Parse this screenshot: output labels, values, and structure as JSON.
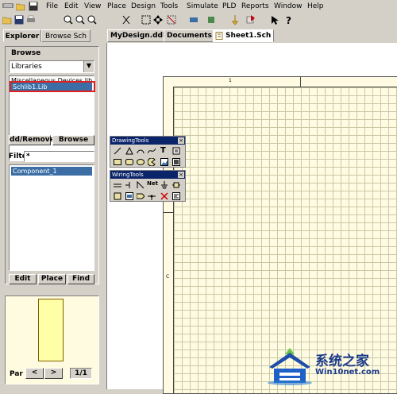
{
  "menu": {
    "items": [
      "File",
      "Edit",
      "View",
      "Place",
      "Design",
      "Tools",
      "Simulate",
      "PLD",
      "Reports",
      "Window",
      "Help"
    ]
  },
  "toolbar": {
    "icons": [
      "open-icon",
      "save-icon",
      "print-icon",
      "zoom-in-icon",
      "zoom-out-icon",
      "zoom-fit-icon",
      "cut-icon",
      "copy-icon",
      "paste-icon",
      "select-icon",
      "move-icon",
      "deselect-icon",
      "wire-icon",
      "component-icon",
      "help-icon"
    ]
  },
  "panel": {
    "tabs": {
      "explorer": "Explorer",
      "browse": "Browse Sch"
    },
    "browse_label": "Browse",
    "combo_value": "Libraries",
    "library_list": {
      "item_cut": "Miscellaneous Devices.lib",
      "selected": "Schlib1.Lib"
    },
    "buttons": {
      "add_remove": "dd/Remove",
      "browse": "Browse"
    },
    "filter_label": "Filte",
    "filter_value": "*",
    "components": [
      "Component_1"
    ],
    "comp_buttons": {
      "edit": "Edit",
      "place": "Place",
      "find": "Find"
    },
    "part_label": "Par",
    "nav_prev": "<",
    "nav_next": ">",
    "part_count": "1/1"
  },
  "doctabs": {
    "tab1": "MyDesign.ddb",
    "tab2": "Documents",
    "tab3": "Sheet1.Sch"
  },
  "sheet": {
    "top_marker": "1",
    "side_marker": "C"
  },
  "drawing_tools": {
    "title": "DrawingTools",
    "close": "×",
    "text_tool": "T"
  },
  "wiring_tools": {
    "title": "WiringTools",
    "close": "×",
    "net_label": "Net"
  },
  "watermark": {
    "cn": "系统之家",
    "url": "Win10net.com"
  },
  "colors": {
    "title_bar": "#0a246a",
    "selection": "#3a6ea5",
    "highlight_box": "#e02020",
    "sheet_bg": "#fffbe2"
  }
}
